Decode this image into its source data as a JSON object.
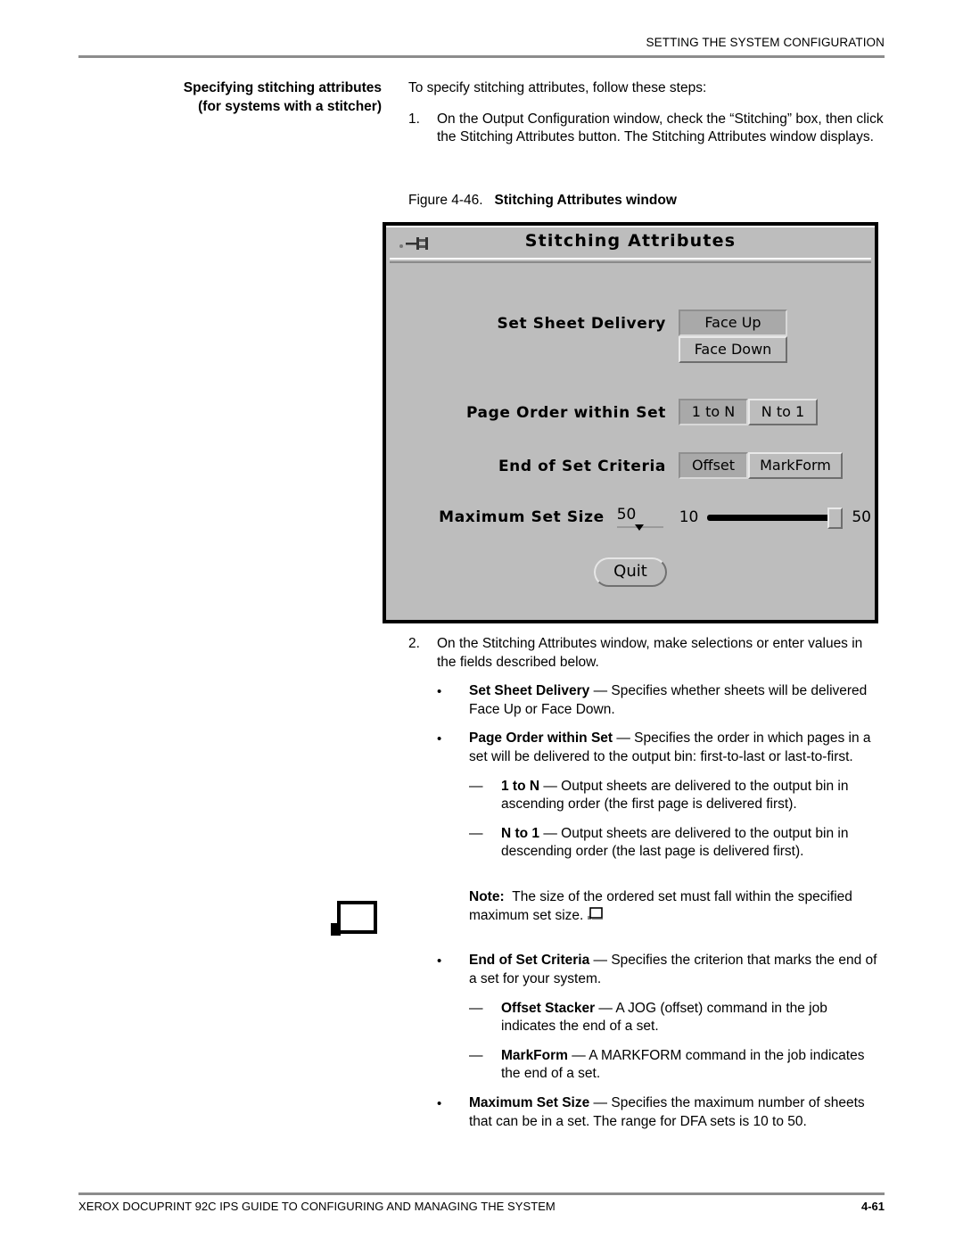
{
  "header": {
    "running_head": "SETTING THE SYSTEM CONFIGURATION"
  },
  "side_heading": {
    "line1": "Specifying stitching attributes",
    "line2": "(for systems with a stitcher)"
  },
  "intro": "To specify stitching attributes, follow these steps:",
  "steps": [
    {
      "number": "1.",
      "text": "On the Output Configuration window, check the “Stitching” box, then click the Stitching Attributes button. The Stitching Attributes window displays."
    },
    {
      "number": "2.",
      "text": "On the Stitching Attributes window, make selections or enter values in the fields described below."
    }
  ],
  "figure": {
    "label": "Figure 4-46.",
    "title": "Stitching Attributes window"
  },
  "dialog": {
    "title": "Stitching Attributes",
    "pushpin_icon": "window-pushpin-icon",
    "rows": [
      {
        "label": "Set Sheet Delivery",
        "options": [
          "Face Up",
          "Face Down"
        ],
        "selected": "Face Up",
        "stacked": true
      },
      {
        "label": "Page Order within Set",
        "options": [
          "1 to N",
          "N to 1"
        ],
        "selected": "1 to N",
        "stacked": false
      },
      {
        "label": "End of Set Criteria",
        "options": [
          "Offset",
          "MarkForm"
        ],
        "selected": "Offset",
        "stacked": false
      }
    ],
    "max_set_size": {
      "label": "Maximum Set Size",
      "value": "50",
      "slider_min": "10",
      "slider_max": "50",
      "slider_percent": 100
    },
    "quit_label": "Quit",
    "colors": {
      "face": "#bdbdbd",
      "selected_face": "#a9a9a9",
      "border": "#000000"
    }
  },
  "descriptions": [
    {
      "kind": "bullet",
      "term": "Set Sheet Delivery",
      "text": " — Specifies whether sheets will be delivered Face Up or Face Down."
    },
    {
      "kind": "bullet",
      "term": "Page Order within Set",
      "text": " — Specifies the order in which pages in a set will be delivered to the output bin: first-to-last or last-to-first."
    },
    {
      "kind": "dash",
      "term": "1 to N",
      "text": " — Output sheets are delivered to the output bin in ascending order (the first page is delivered first)."
    },
    {
      "kind": "dash",
      "term": "N to 1",
      "text": " — Output sheets are delivered to the output bin in descending order (the last page is delivered first)."
    }
  ],
  "note": {
    "label": "Note:",
    "text": "The size of the ordered set must fall within the specified maximum set size.",
    "margin_icon": "note-page-icon",
    "end_marker_icon": "note-end-icon"
  },
  "descriptions2": [
    {
      "kind": "bullet",
      "term": "End of Set Criteria",
      "text": " — Specifies the criterion that marks the end of a set for your system."
    },
    {
      "kind": "dash",
      "term": "Offset Stacker",
      "text": " — A JOG (offset) command in the job indicates the end of a set."
    },
    {
      "kind": "dash",
      "term": "MarkForm",
      "text": " — A MARKFORM command in the job indicates the end of a set."
    },
    {
      "kind": "bullet",
      "term": "Maximum Set Size",
      "text": " — Specifies the maximum number of sheets that can be in a set. The range for DFA sets is 10 to 50."
    }
  ],
  "footer": {
    "left": "XEROX DOCUPRINT 92C IPS GUIDE TO CONFIGURING AND MANAGING THE SYSTEM",
    "page_number": "4-61"
  }
}
